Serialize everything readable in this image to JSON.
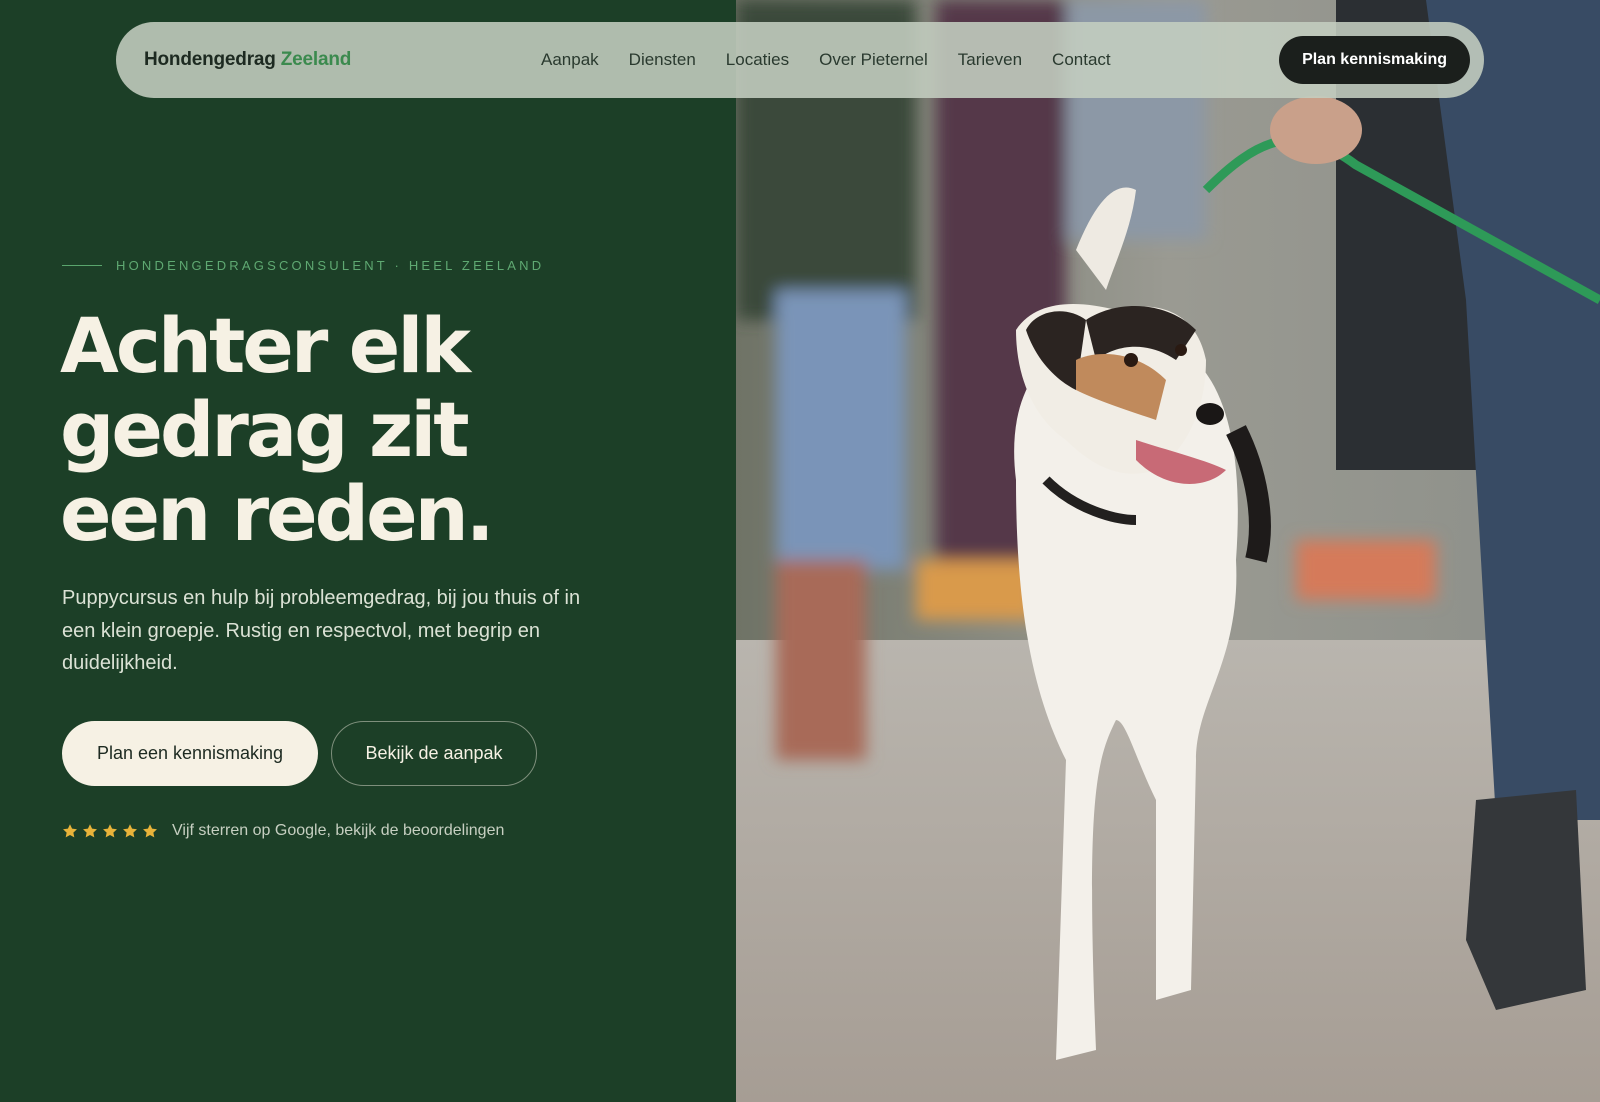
{
  "nav": {
    "brand_main": "Hondengedrag",
    "brand_accent": "Zeeland",
    "links": [
      "Aanpak",
      "Diensten",
      "Locaties",
      "Over Pieternel",
      "Tarieven",
      "Contact"
    ],
    "cta": "Plan kennismaking"
  },
  "hero": {
    "eyebrow": "HONDENGEDRAGSCONSULENT · HEEL ZEELAND",
    "headline": [
      "Achter elk",
      "gedrag zit",
      "een reden."
    ],
    "lead": "Puppycursus en hulp bij probleemgedrag, bij jou thuis of in een klein groepje. Rustig en respectvol, met begrip en duidelijkheid.",
    "primary_cta": "Plan een kennismaking",
    "secondary_cta": "Bekijk de aanpak",
    "rating": {
      "stars": 5,
      "text": "Vijf sterren op Google, bekijk de beoordelingen"
    }
  },
  "colors": {
    "panel": "#1c3f27",
    "accent": "#3b8a4e",
    "cream": "#f6f1e4",
    "star": "#e8b33a"
  },
  "icons": {
    "star": "star-icon"
  }
}
